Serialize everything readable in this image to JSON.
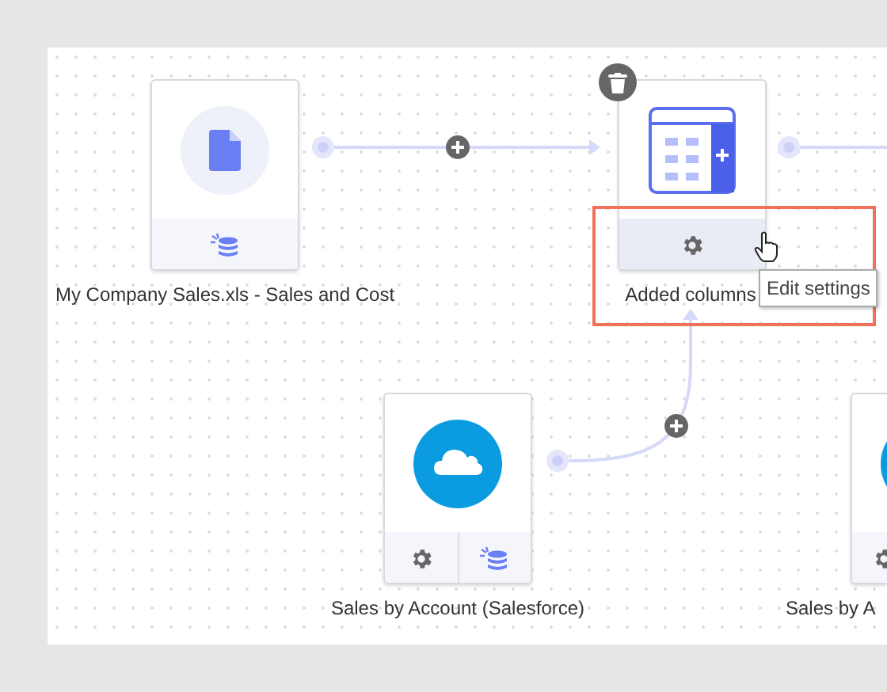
{
  "nodes": [
    {
      "kind": "file",
      "label": "My Company Sales.xls - Sales and Cost",
      "selected": false,
      "buttons": [
        {
          "kind": "data",
          "hovered": false
        }
      ]
    },
    {
      "kind": "table",
      "label": "Added columns",
      "selected": true,
      "buttons": [
        {
          "kind": "settings",
          "hovered": true,
          "tooltip": "Edit settings"
        }
      ]
    },
    {
      "kind": "cloud",
      "label": "Sales by Account (Salesforce)",
      "selected": false,
      "buttons": [
        {
          "kind": "settings",
          "hovered": false
        },
        {
          "kind": "data",
          "hovered": false
        }
      ]
    },
    {
      "kind": "cloud",
      "label": "Sales by A",
      "selected": false,
      "buttons": [
        {
          "kind": "settings",
          "hovered": false
        }
      ]
    }
  ]
}
